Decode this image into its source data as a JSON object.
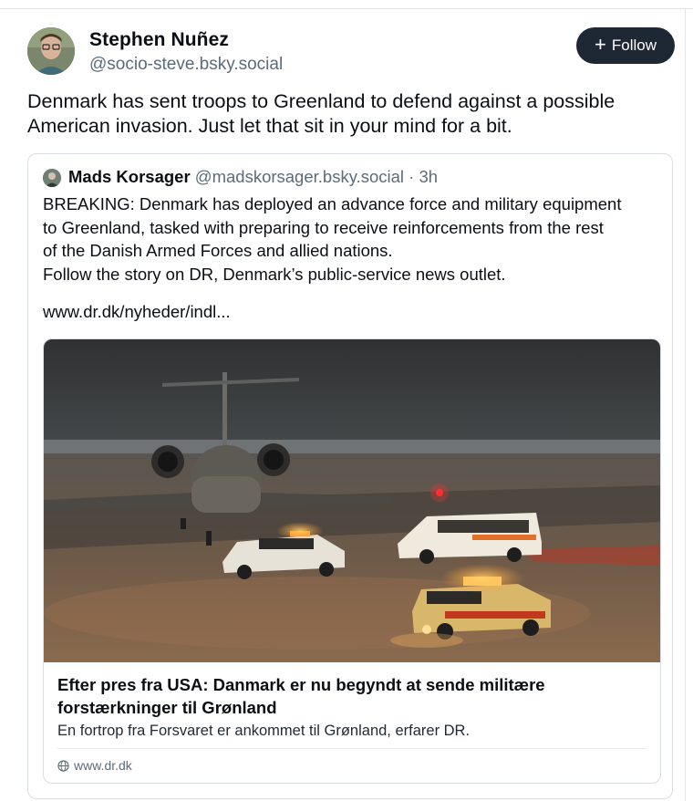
{
  "post": {
    "author_name": "Stephen Nuñez",
    "author_handle": "@socio-steve.bsky.social",
    "follow_label": "Follow",
    "text_lines": [
      "Denmark has sent troops to Greenland to defend against a possible",
      "American invasion. Just let that sit in your mind for a bit."
    ]
  },
  "quote": {
    "author_name": "Mads Korsager",
    "author_handle": "@madskorsager.bsky.social",
    "separator": " · ",
    "time": "3h",
    "text_lines": [
      "BREAKING: Denmark has deployed an advance force and military equipment",
      "to Greenland, tasked with preparing to receive reinforcements from the rest",
      "of the Danish Armed Forces and allied nations.",
      "Follow the story on DR, Denmark’s public-service news outlet."
    ],
    "link_text": "www.dr.dk/nyheder/indl...",
    "card": {
      "title_lines": [
        "Efter pres fra USA: Danmark er nu begyndt at sende militære",
        "forstærkninger til Grønland"
      ],
      "description": "En fortrop fra Forsvaret er ankommet til Grønland, erfarer DR.",
      "domain": "www.dr.dk"
    }
  },
  "icons": {
    "follow": "plus-icon",
    "domain": "globe-icon"
  },
  "colors": {
    "follow_bg": "#1e2834",
    "secondary_text": "#5b6b7c",
    "border": "#d8dde3"
  }
}
